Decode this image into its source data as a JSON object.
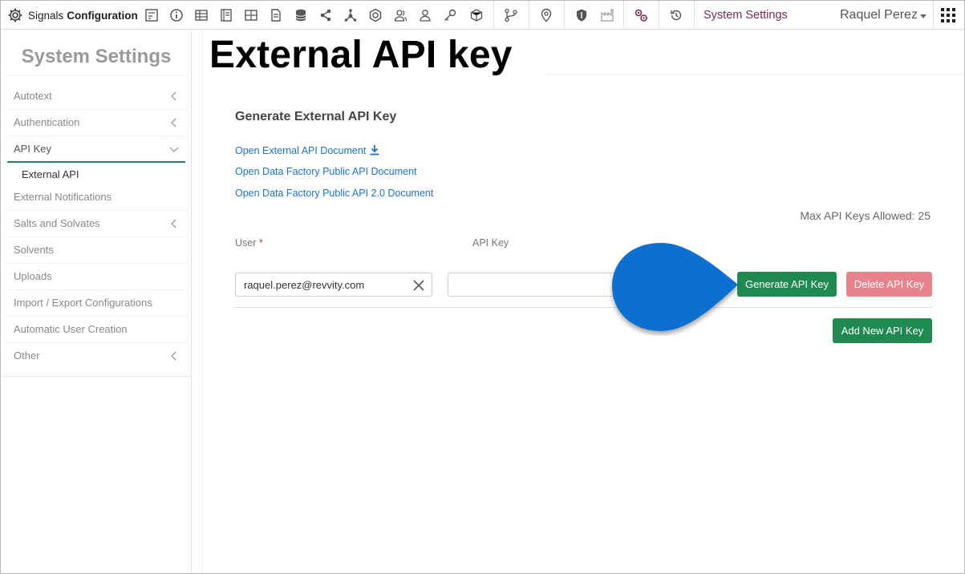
{
  "header": {
    "brand_prefix": "Signals",
    "brand_main": "Configuration",
    "icons": [
      "form-icon",
      "info-icon",
      "table-icon",
      "notebook-icon",
      "grid-icon",
      "document-icon",
      "database-icon",
      "share-icon",
      "network-icon",
      "hexagon-icon",
      "users-icon",
      "user-icon",
      "key-icon",
      "cube-icon",
      "branch-icon",
      "location-icon",
      "shield-icon",
      "factory-icon",
      "settings-gears-icon",
      "history-icon"
    ],
    "system_settings_link": "System Settings",
    "user_name": "Raquel Perez"
  },
  "sidebar": {
    "title": "System Settings",
    "items": [
      {
        "label": "Autotext",
        "chevron": "left"
      },
      {
        "label": "Authentication",
        "chevron": "left"
      },
      {
        "label": "API Key",
        "chevron": "down",
        "active": true
      },
      {
        "label": "External API",
        "sub": true
      },
      {
        "label": "External Notifications"
      },
      {
        "label": "Salts and Solvates",
        "chevron": "left"
      },
      {
        "label": "Solvents"
      },
      {
        "label": "Uploads"
      },
      {
        "label": "Import / Export Configurations"
      },
      {
        "label": "Automatic User Creation"
      },
      {
        "label": "Other",
        "chevron": "left"
      }
    ]
  },
  "main": {
    "page_title": "External API key",
    "section_heading": "Generate External API Key",
    "links": [
      "Open External API Document",
      "Open Data Factory Public API Document",
      "Open Data Factory Public API 2.0 Document"
    ],
    "max_keys_text": "Max API Keys Allowed: 25",
    "user_column_label": "User",
    "required_marker": "*",
    "api_key_column_label": "API Key",
    "user_value": "raquel.perez@revvity.com",
    "api_key_value": "",
    "generate_button": "Generate API Key",
    "delete_button": "Delete API Key",
    "add_button": "Add New API Key"
  },
  "colors": {
    "accent_green": "#1e8a4f",
    "delete_red": "#e9838b",
    "link_blue": "#1a73d1",
    "callout_blue": "#0b6fd0",
    "system_link": "#7a2a58"
  }
}
